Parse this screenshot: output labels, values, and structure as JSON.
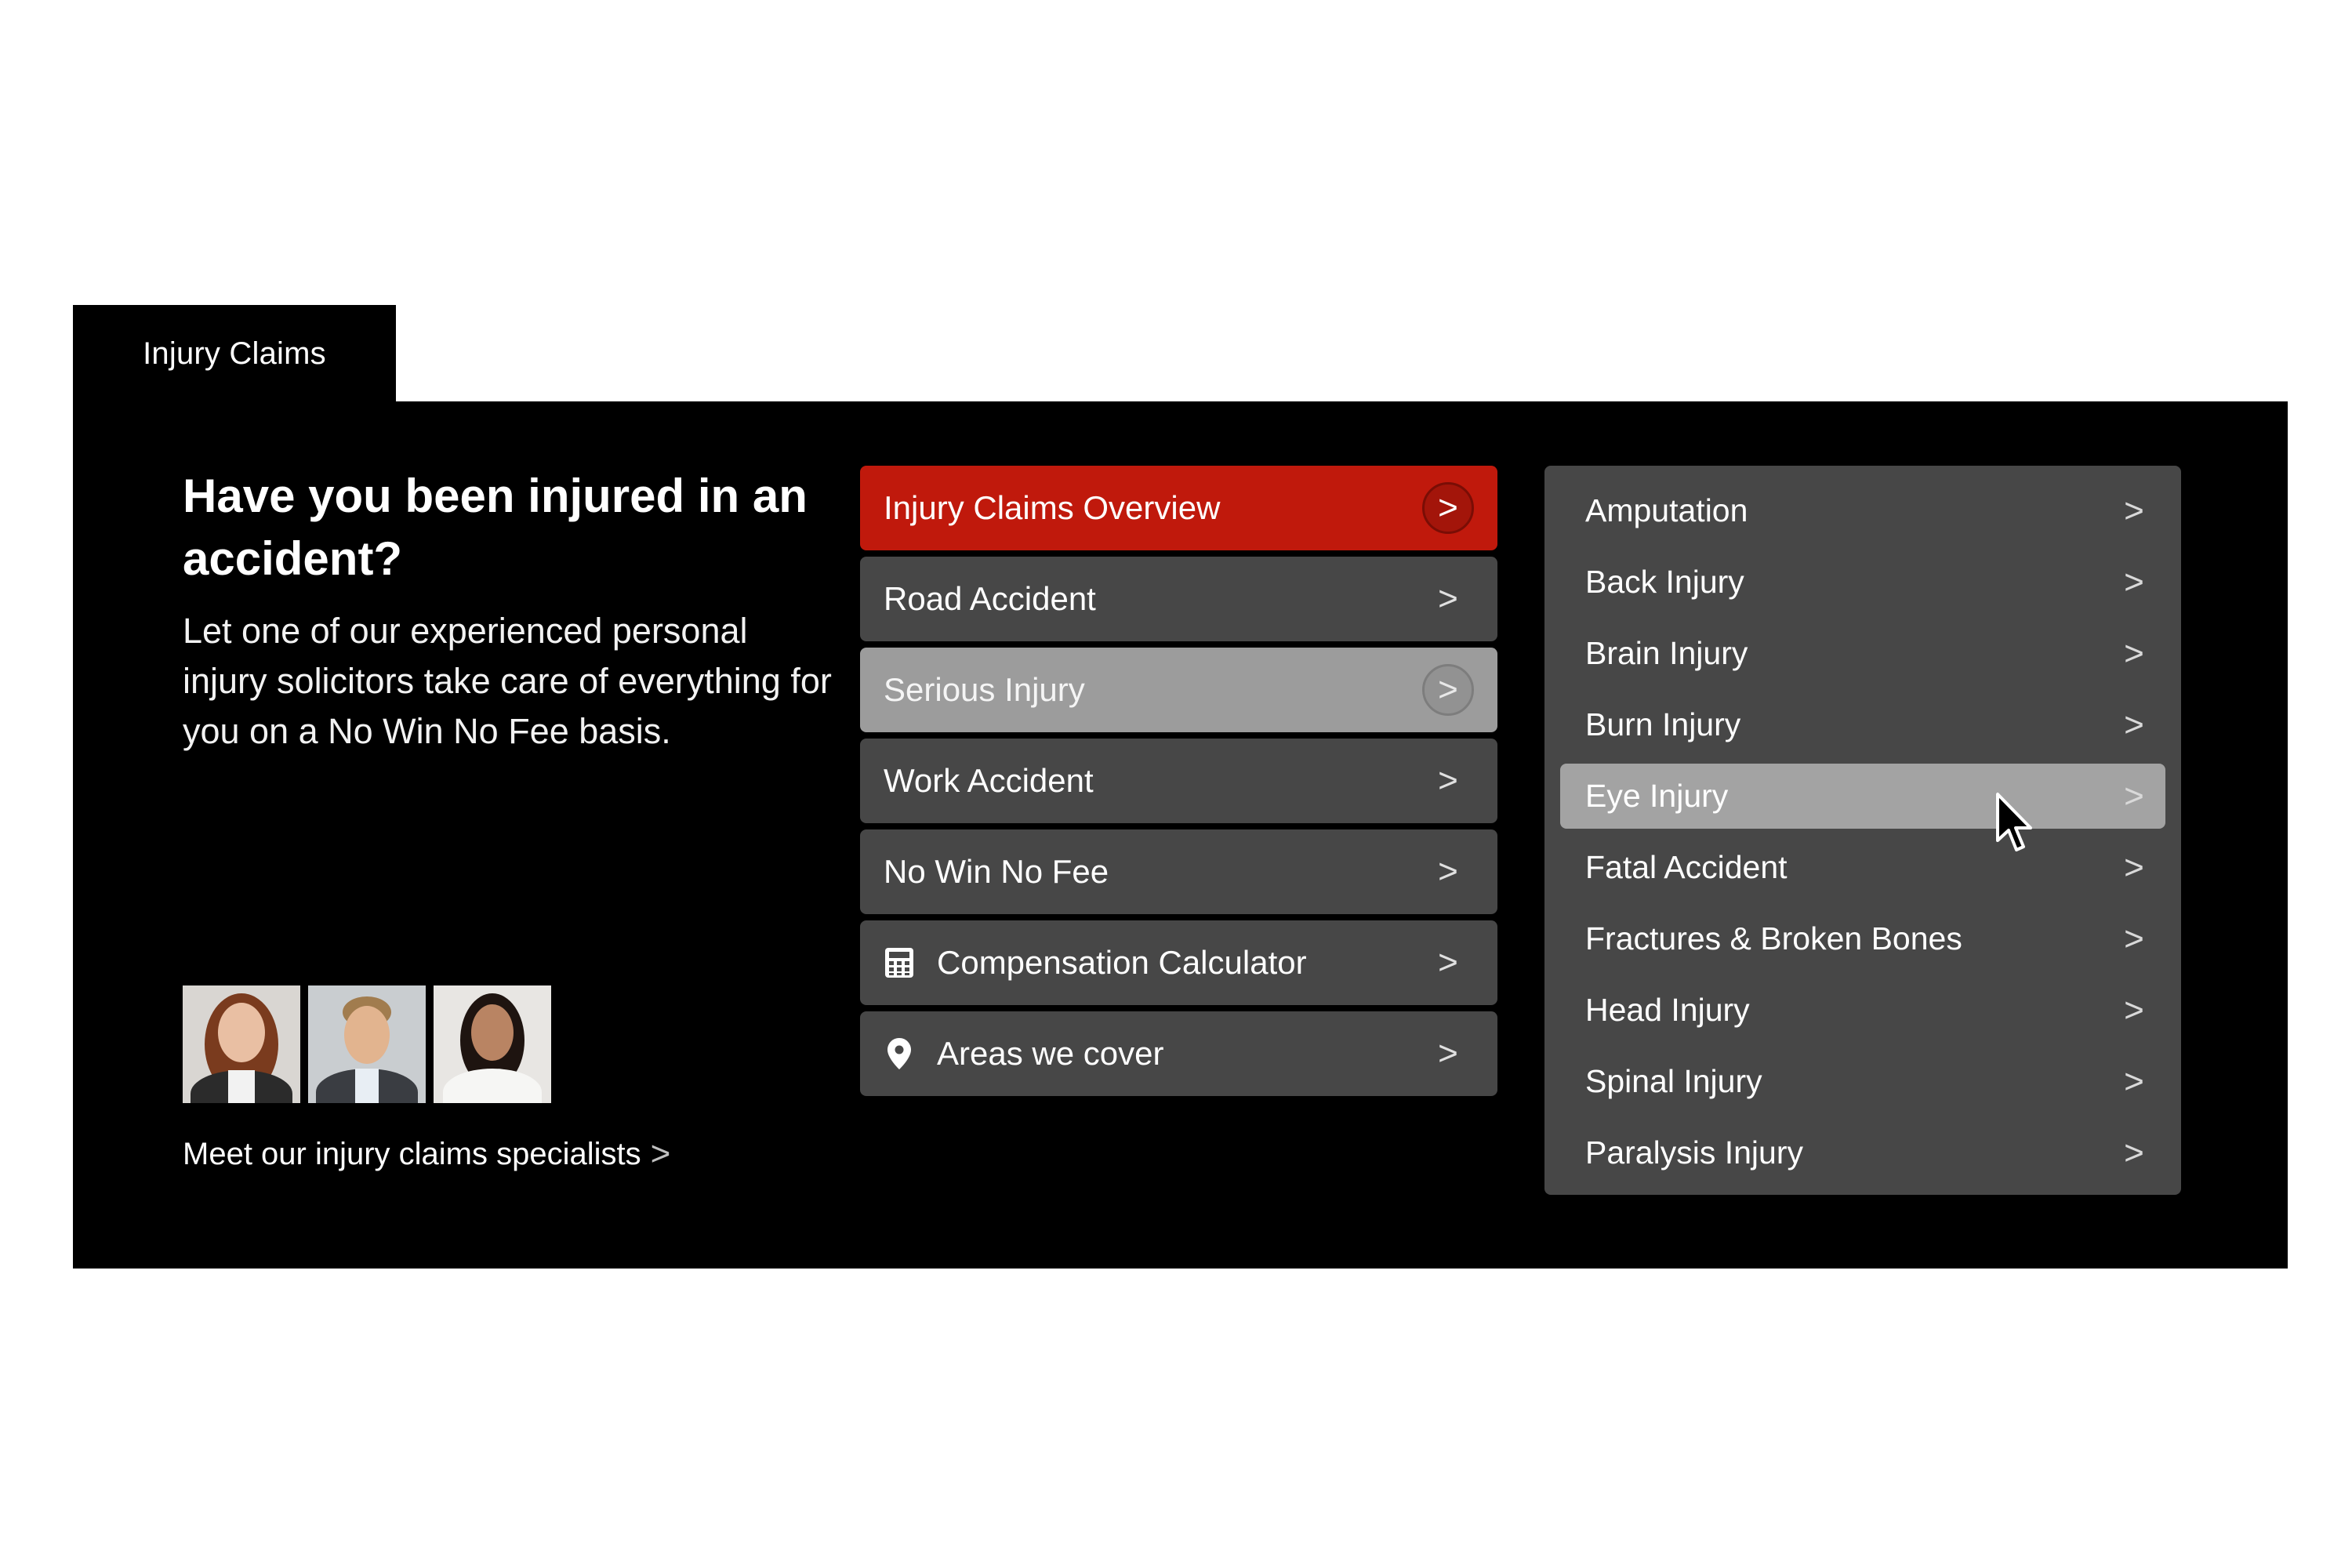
{
  "tab": {
    "label": "Injury Claims"
  },
  "intro": {
    "heading": "Have you been injured in an accident?",
    "body": "Let one of our experienced personal injury solicitors take care of everything for you on a No Win No Fee basis."
  },
  "specialists": {
    "link_label": "Meet our injury claims specialists",
    "chevron": ">"
  },
  "menu": {
    "items": [
      {
        "label": "Injury Claims Overview",
        "icon": "",
        "state": "active",
        "arrow": ">"
      },
      {
        "label": "Road Accident",
        "icon": "",
        "state": "normal",
        "arrow": ">"
      },
      {
        "label": "Serious Injury",
        "icon": "",
        "state": "hover",
        "arrow": ">"
      },
      {
        "label": "Work Accident",
        "icon": "",
        "state": "normal",
        "arrow": ">"
      },
      {
        "label": "No Win No Fee",
        "icon": "",
        "state": "normal",
        "arrow": ">"
      },
      {
        "label": "Compensation Calculator",
        "icon": "calculator-icon",
        "state": "normal",
        "arrow": ">"
      },
      {
        "label": "Areas we cover",
        "icon": "location-pin-icon",
        "state": "normal",
        "arrow": ">"
      }
    ]
  },
  "submenu": {
    "items": [
      {
        "label": "Amputation",
        "arrow": ">"
      },
      {
        "label": "Back Injury",
        "arrow": ">"
      },
      {
        "label": "Brain Injury",
        "arrow": ">"
      },
      {
        "label": "Burn Injury",
        "arrow": ">"
      },
      {
        "label": "Eye Injury",
        "arrow": ">",
        "state": "hover"
      },
      {
        "label": "Fatal Accident",
        "arrow": ">"
      },
      {
        "label": "Fractures & Broken Bones",
        "arrow": ">"
      },
      {
        "label": "Head Injury",
        "arrow": ">"
      },
      {
        "label": "Spinal Injury",
        "arrow": ">"
      },
      {
        "label": "Paralysis Injury",
        "arrow": ">"
      }
    ]
  },
  "colors": {
    "panel_bg": "#000000",
    "item_bg": "#474747",
    "active_bg": "#c0190c",
    "hover_bg": "#9c9c9c"
  }
}
